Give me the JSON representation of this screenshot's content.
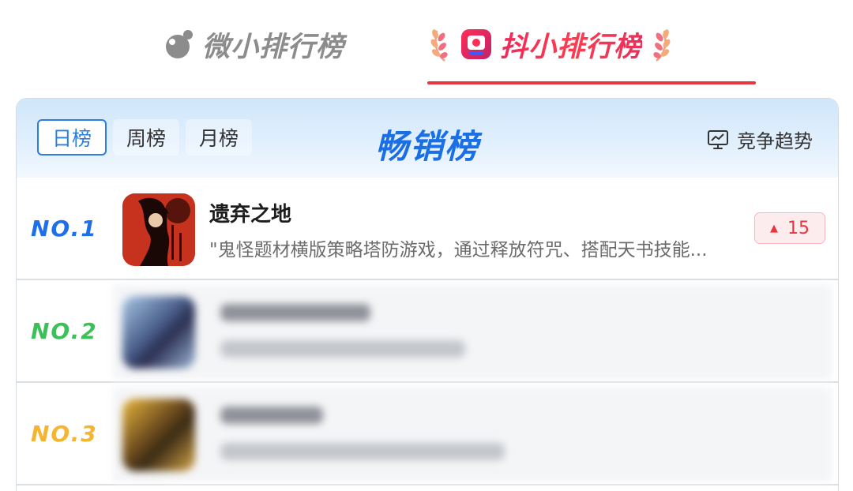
{
  "platform_tabs": [
    {
      "label": "微小排行榜",
      "active": false
    },
    {
      "label": "抖小排行榜",
      "active": true
    }
  ],
  "header": {
    "period_tabs": [
      {
        "label": "日榜",
        "active": true
      },
      {
        "label": "周榜",
        "active": false
      },
      {
        "label": "月榜",
        "active": false
      }
    ],
    "title": "畅销榜",
    "trend_label": "竞争趋势"
  },
  "rankings": [
    {
      "rank": "NO.1",
      "name": "遗弃之地",
      "description": "\"鬼怪题材横版策略塔防游戏，通过释放符咒、搭配天书技能...",
      "change": "15",
      "change_direction": "up",
      "blurred": false
    },
    {
      "rank": "NO.2",
      "blurred": true
    },
    {
      "rank": "NO.3",
      "blurred": true
    }
  ],
  "colors": {
    "accent_blue": "#1f6fea",
    "douyin_red": "#e6363f",
    "rank_2": "#3cc15a",
    "rank_3": "#f5b531"
  }
}
